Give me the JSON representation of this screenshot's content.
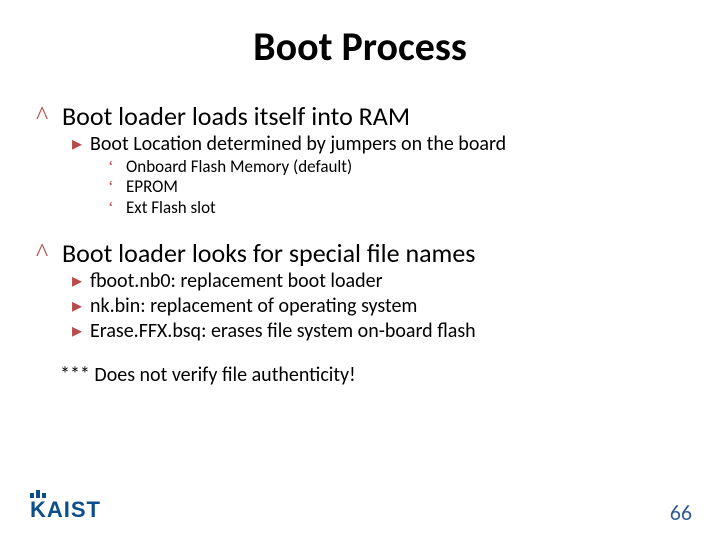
{
  "title": "Boot Process",
  "content": {
    "a": {
      "heading": "Boot loader loads itself into RAM",
      "sub1": "Boot Location determined by jumpers on the board",
      "items": {
        "i1": "Onboard Flash Memory (default)",
        "i2": "EPROM",
        "i3": "Ext Flash slot"
      }
    },
    "b": {
      "heading": "Boot loader looks for special file names",
      "items": {
        "i1": "fboot.nb0: replacement boot loader",
        "i2": "nk.bin: replacement of operating system",
        "i3": "Erase.FFX.bsq: erases file system on-board flash"
      }
    },
    "note": "*** Does not verify file authenticity!"
  },
  "footer": {
    "logo_text": "KAIST",
    "page_number": "66"
  },
  "bullets": {
    "l1": "^",
    "l2": "▸",
    "l3": "‘"
  }
}
